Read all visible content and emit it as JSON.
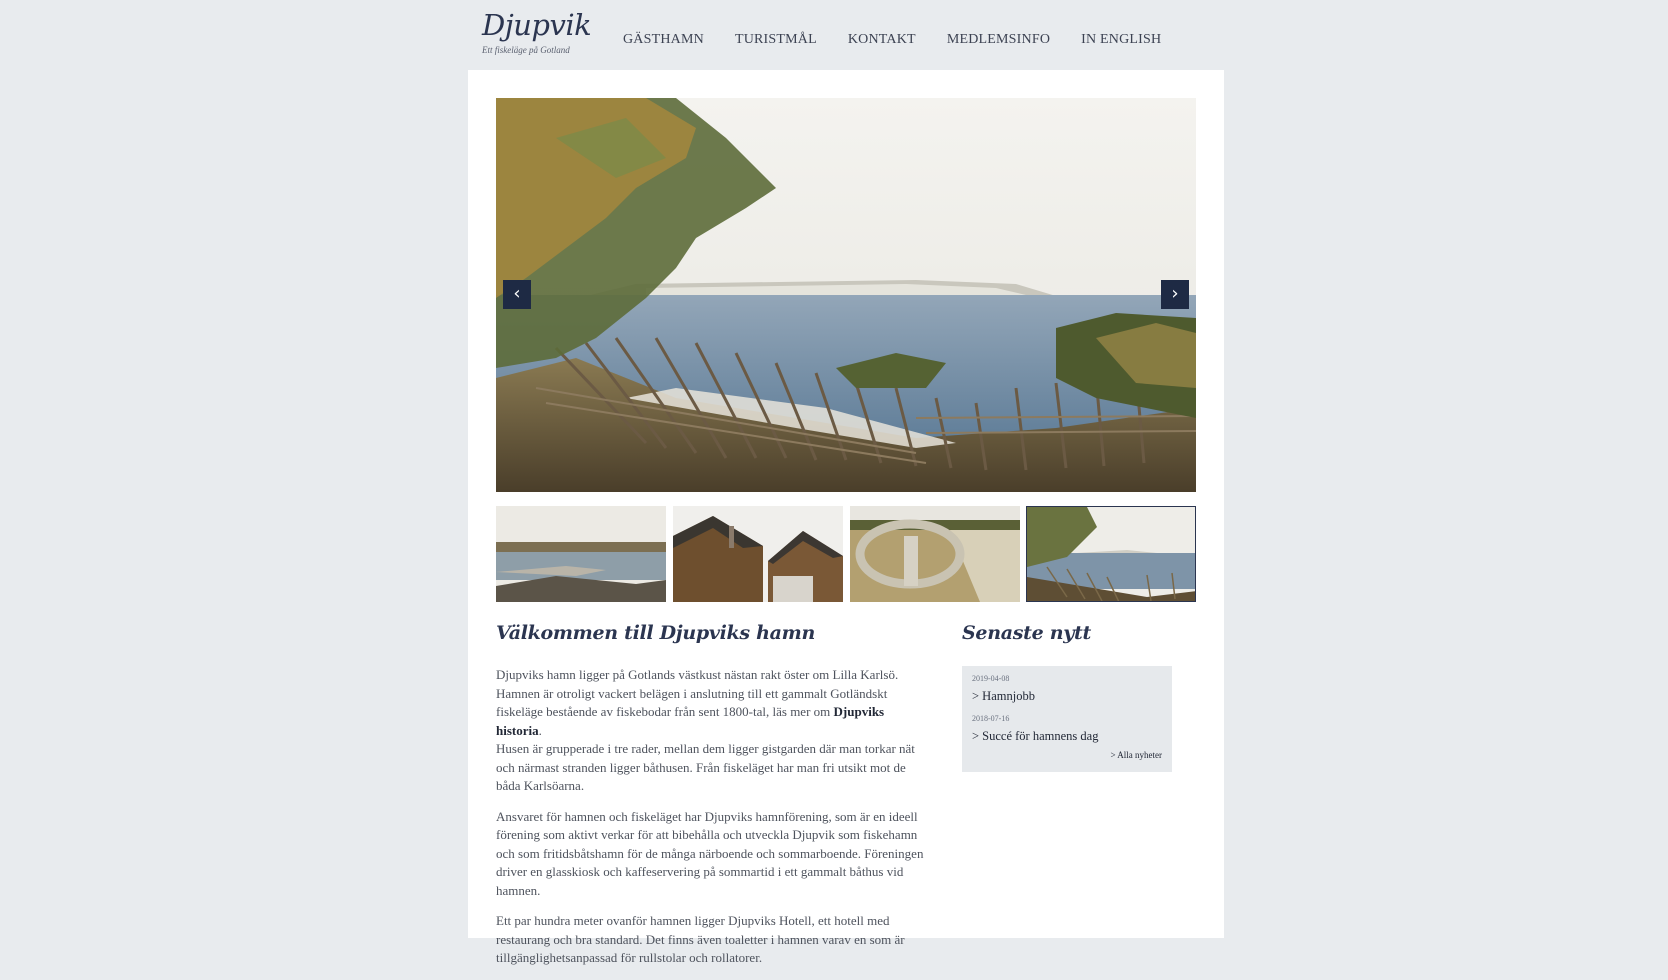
{
  "brand": {
    "title": "Djupvik",
    "subtitle": "Ett fiskeläge på Gotland"
  },
  "nav": [
    {
      "label": "GÄSTHAMN"
    },
    {
      "label": "TURISTMÅL"
    },
    {
      "label": "KONTAKT"
    },
    {
      "label": "MEDLEMSINFO"
    },
    {
      "label": "IN ENGLISH"
    }
  ],
  "slider": {
    "prev_icon": "chevron-left-icon",
    "next_icon": "chevron-right-icon",
    "prev_glyph": "‹",
    "next_glyph": "›",
    "active_index": 3
  },
  "welcome": {
    "heading": "Välkommen till Djupviks hamn",
    "p1_before": "Djupviks hamn ligger på Gotlands västkust nästan rakt öster om Lilla Karlsö. Hamnen är otroligt vackert belägen i anslutning till ett gammalt Gotländskt fiskeläge bestående av fiskebodar från sent 1800-tal, läs mer om",
    "p1_link": "Djupviks historia",
    "p1_after": ".",
    "p1_line2": "Husen är grupperade i tre rader, mellan dem ligger gistgarden där man torkar nät och närmast stranden ligger båthusen. Från fiskeläget har man fri utsikt mot de båda Karlsöarna.",
    "p2": "Ansvaret för hamnen och fiskeläget har Djupviks hamnförening, som är en ideell förening som aktivt verkar för att bibehålla och utveckla Djupvik som fiskehamn och som fritidsbåtshamn för de många närboende och sommarboende. Föreningen driver en glasskiosk och kaffeservering på sommartid i ett gammalt båthus vid hamnen.",
    "p3": "Ett par hundra meter ovanför hamnen ligger Djupviks Hotell, ett hotell med restaurang och bra standard. Det finns även toaletter i hamnen varav en som är tillgänglighetsanpassad för rullstolar och rollatorer."
  },
  "news": {
    "heading": "Senaste nytt",
    "items": [
      {
        "date": "2019-04-08",
        "title": "> Hamnjobb"
      },
      {
        "date": "2018-07-16",
        "title": "> Succé för hamnens dag"
      }
    ],
    "all_label": "> Alla nyheter"
  },
  "colors": {
    "page_bg": "#e8ebee",
    "accent": "#2b3550",
    "arrow_bg": "#1e2a44",
    "news_bg": "#e6e9ec"
  }
}
